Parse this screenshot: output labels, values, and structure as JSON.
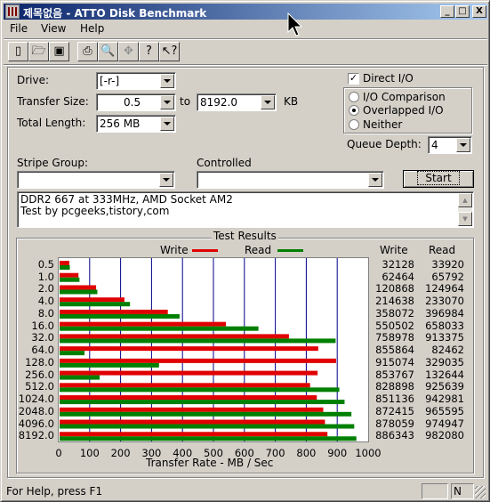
{
  "window": {
    "title": "제목없음 - ATTO Disk Benchmark",
    "minimize": "_",
    "maximize": "□",
    "close": "X"
  },
  "menu": [
    "File",
    "View",
    "Help"
  ],
  "toolbar_icons": [
    "new-file-icon",
    "open-folder-icon",
    "save-icon",
    "print-icon",
    "print-preview-icon",
    "move-icon",
    "help-icon",
    "context-help-icon"
  ],
  "form": {
    "drive_label": "Drive:",
    "drive_value": "[-r-]",
    "transfer_size_label": "Transfer Size:",
    "transfer_from": "0.5",
    "to_label": "to",
    "transfer_to": "8192.0",
    "kb_label": "KB",
    "total_length_label": "Total Length:",
    "total_length_value": "256 MB",
    "direct_io_label": "Direct I/O",
    "direct_io_checked": true,
    "io_options": [
      {
        "label": "I/O Comparison",
        "selected": false
      },
      {
        "label": "Overlapped I/O",
        "selected": true
      },
      {
        "label": "Neither",
        "selected": false
      }
    ],
    "queue_depth_label": "Queue Depth:",
    "queue_depth_value": "4",
    "stripe_group_label": "Stripe Group:",
    "stripe_group_value": "",
    "controlled_label": "Controlled",
    "controlled_value": "",
    "start_label": "Start"
  },
  "notes": {
    "line1": "DDR2 667 at 333MHz, AMD Socket AM2",
    "line2": "Test by pcgeeks,tistory,com"
  },
  "results": {
    "group_title": "Test Results",
    "legend_write": "Write",
    "legend_read": "Read",
    "col_write": "Write",
    "col_read": "Read",
    "xlabel": "Transfer Rate - MB / Sec",
    "write_color": "#e00000",
    "read_color": "#008000"
  },
  "chart_data": {
    "type": "bar",
    "orientation": "horizontal",
    "categories": [
      "0.5",
      "1.0",
      "2.0",
      "4.0",
      "8.0",
      "16.0",
      "32.0",
      "64.0",
      "128.0",
      "256.0",
      "512.0",
      "1024.0",
      "2048.0",
      "4096.0",
      "8192.0"
    ],
    "series": [
      {
        "name": "Write",
        "values": [
          32128,
          62464,
          120868,
          214638,
          358072,
          550502,
          758978,
          855864,
          915074,
          853767,
          828898,
          851136,
          872415,
          878059,
          886343
        ]
      },
      {
        "name": "Read",
        "values": [
          33920,
          65792,
          124964,
          233070,
          396984,
          658033,
          913375,
          82462,
          329035,
          132644,
          925639,
          942981,
          965595,
          974947,
          982080
        ]
      }
    ],
    "xticks": [
      "0",
      "100",
      "200",
      "300",
      "400",
      "500",
      "600",
      "700",
      "800",
      "900",
      "1000"
    ],
    "xlim": [
      0,
      1000
    ],
    "xlabel": "Transfer Rate - MB / Sec"
  },
  "status": {
    "text": "For Help, press F1",
    "indicator": "N"
  }
}
